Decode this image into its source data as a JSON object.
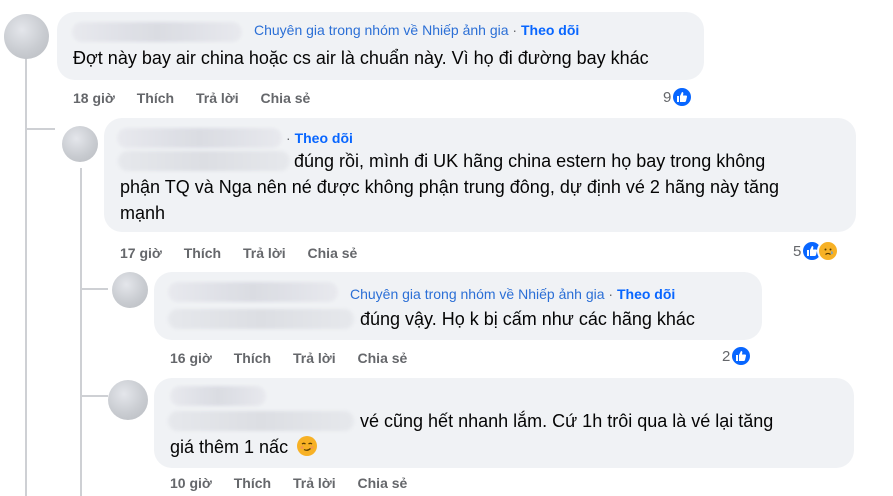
{
  "comments": [
    {
      "badge": "Chuyên gia trong nhóm về Nhiếp ảnh gia",
      "separator": "·",
      "follow": "Theo dõi",
      "text": "Đợt này bay air china hoặc cs air là chuẩn này. Vì họ đi đường bay khác",
      "time": "18 giờ",
      "like": "Thích",
      "reply": "Trả lời",
      "share": "Chia sẻ",
      "reaction_count": "9",
      "reactions": [
        "like-icon"
      ]
    },
    {
      "separator": "·",
      "follow": "Theo dõi",
      "text_line1": "đúng rồi, mình đi UK hãng china estern họ bay trong không",
      "text_line2": "phận TQ và Nga nên né được không phận trung đông, dự định vé 2 hãng này tăng",
      "text_line3": "mạnh",
      "time": "17 giờ",
      "like": "Thích",
      "reply": "Trả lời",
      "share": "Chia sẻ",
      "reaction_count": "5",
      "reactions": [
        "like-icon",
        "sad-icon"
      ]
    },
    {
      "badge": "Chuyên gia trong nhóm về Nhiếp ảnh gia",
      "separator": "·",
      "follow": "Theo dõi",
      "text": "đúng vậy. Họ k bị cấm như các hãng khác",
      "time": "16 giờ",
      "like": "Thích",
      "reply": "Trả lời",
      "share": "Chia sẻ",
      "reaction_count": "2",
      "reactions": [
        "like-icon"
      ]
    },
    {
      "text_line1": "vé cũng hết nhanh lắm. Cứ 1h trôi qua là vé lại tăng",
      "text_line2": "giá thêm 1 nấc",
      "emoji": "smirk-face-icon",
      "time": "10 giờ",
      "like": "Thích",
      "reply": "Trả lời",
      "share": "Chia sẻ"
    }
  ],
  "colors": {
    "bubble": "#f0f2f5",
    "link": "#0866ff",
    "meta_text": "#65676b",
    "thread_line": "#ced0d4"
  }
}
